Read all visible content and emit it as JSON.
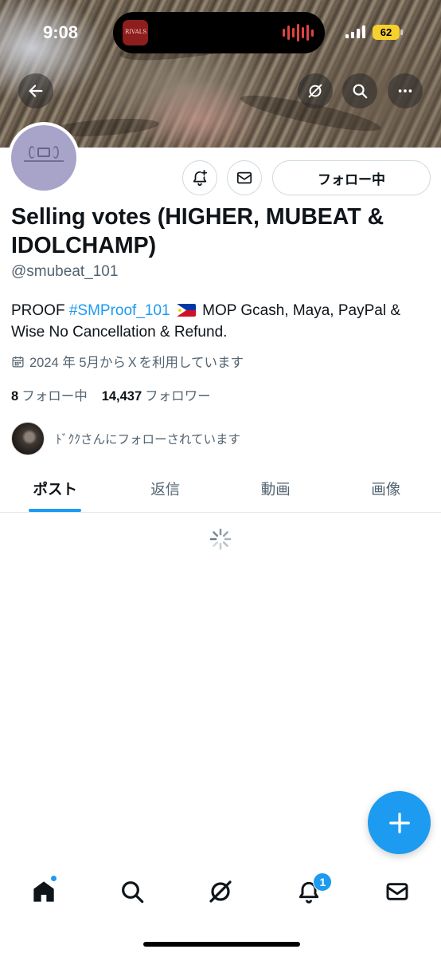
{
  "status_bar": {
    "time": "9:08",
    "battery": "62",
    "album_art_text": "RIVALS"
  },
  "banner": {
    "back_icon": "arrow-left-icon",
    "grok_icon": "grok-icon",
    "search_icon": "search-icon",
    "more_icon": "more-horizontal-icon"
  },
  "profile": {
    "name": "Selling votes (HIGHER, MUBEAT & IDOLCHAMP)",
    "handle": "@smubeat_101",
    "bio_prefix": "PROOF ",
    "bio_hashtag": "#SMProof_101",
    "bio_suffix": " MOP Gcash, Maya, PayPal & Wise No Cancellation & Refund.",
    "joined": "2024 年 5月からＸを利用しています",
    "following_count": "8",
    "following_label": "フォロー中",
    "followers_count": "14,437",
    "followers_label": "フォロワー",
    "followed_by": "ﾄﾞｸｸさんにフォローされています",
    "follow_button": "フォロー中"
  },
  "tabs": [
    {
      "label": "ポスト",
      "active": true
    },
    {
      "label": "返信",
      "active": false
    },
    {
      "label": "動画",
      "active": false
    },
    {
      "label": "画像",
      "active": false
    }
  ],
  "bottom_nav": {
    "items": [
      "home-icon",
      "search-icon",
      "grok-icon",
      "notifications-icon",
      "messages-icon"
    ],
    "notifications_badge": "1"
  },
  "colors": {
    "accent": "#1d9bf0",
    "text_primary": "#0f1419",
    "text_secondary": "#536471",
    "border": "#cfd9de"
  }
}
